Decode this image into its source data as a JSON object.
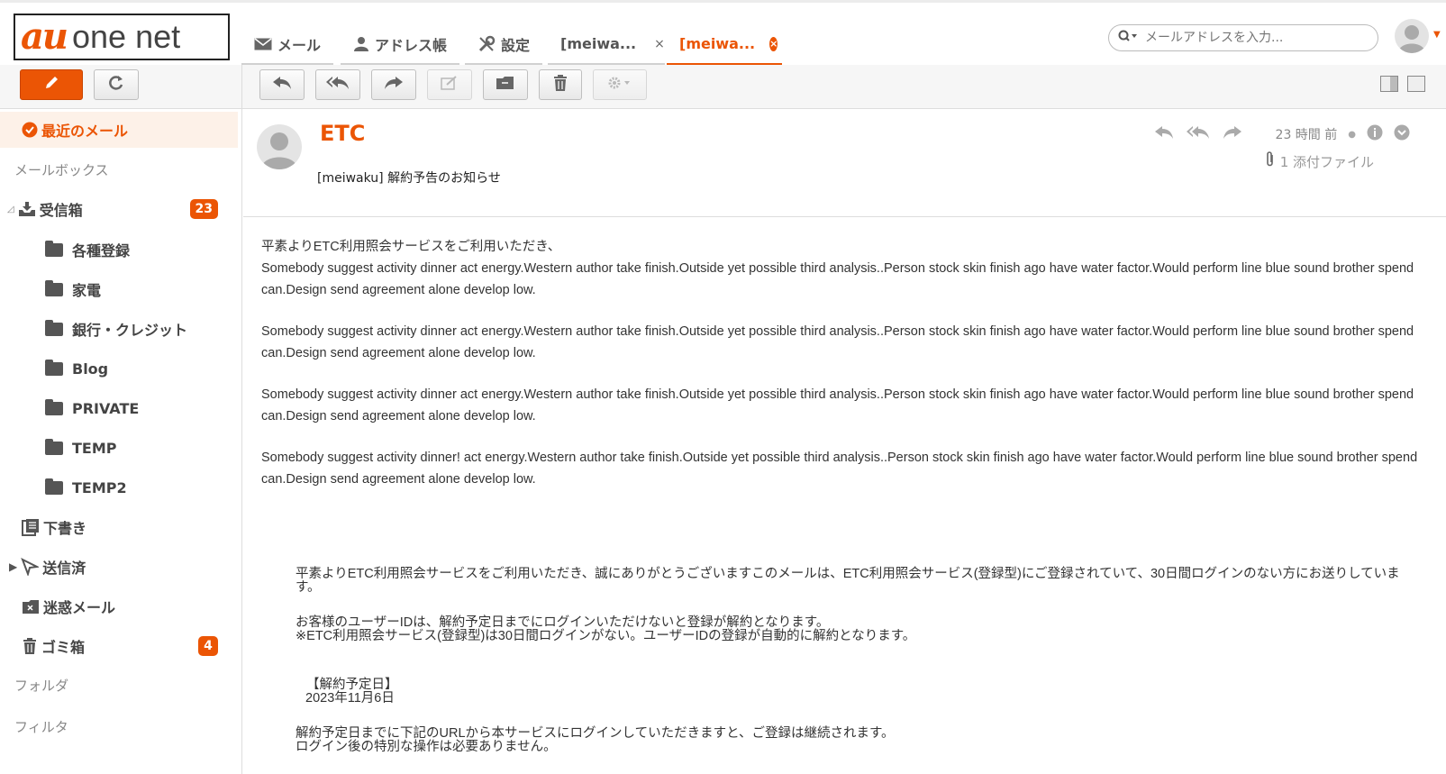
{
  "brand": {
    "logo_au": "au",
    "logo_net": "one net"
  },
  "tabs": [
    {
      "label": "メール"
    },
    {
      "label": "アドレス帳"
    },
    {
      "label": "設定"
    },
    {
      "label": "[meiwa...",
      "close": "×"
    },
    {
      "label": "[meiwa...",
      "close": "×",
      "active": true
    }
  ],
  "search": {
    "placeholder": "メールアドレスを入力..."
  },
  "sidebar": {
    "recent": "最近のメール",
    "mailbox_heading": "メールボックス",
    "inbox": {
      "label": "受信箱",
      "count": "23"
    },
    "folders": [
      "各種登録",
      "家電",
      "銀行・クレジット",
      "Blog",
      "PRIVATE",
      "TEMP",
      "TEMP2"
    ],
    "drafts": "下書き",
    "sent": "送信済",
    "spam": "迷惑メール",
    "trash": {
      "label": "ゴミ箱",
      "count": "4"
    },
    "folder_heading": "フォルダ",
    "filter_heading": "フィルタ"
  },
  "message": {
    "sender": "ETC",
    "subject": "[meiwaku] 解約予告のお知らせ",
    "time": "23 時間 前",
    "attachments": "1 添付ファイル",
    "body_lines": [
      "平素よりETC利用照会サービスをご利用いただき、",
      "Somebody suggest activity dinner act energy.Western author take finish.Outside yet possible third analysis..Person stock skin finish ago have water factor.Would perform line blue sound brother spend can.Design send agreement alone develop low.",
      "Somebody suggest activity dinner act energy.Western author take finish.Outside yet possible third analysis..Person stock skin finish ago have water factor.Would perform line blue sound brother spend can.Design send agreement alone develop low.",
      "Somebody suggest activity dinner act energy.Western author take finish.Outside yet possible third analysis..Person stock skin finish ago have water factor.Would perform line blue sound brother spend can.Design send agreement alone develop low.",
      "Somebody suggest activity dinner! act energy.Western author take finish.Outside yet possible third analysis..Person stock skin finish ago have water factor.Would perform line blue sound brother spend can.Design send agreement alone develop low."
    ],
    "notice": {
      "p1": "平素よりETC利用照会サービスをご利用いただき、誠にありがとうございますこのメールは、ETC利用照会サービス(登録型)にご登録されていて、30日間ログインのない方にお送りしています。",
      "p2a": "お客様のユーザーIDは、解約予定日までにログインいただけないと登録が解約となります。",
      "p2b": "※ETC利用照会サービス(登録型)は30日間ログインがない。ユーザーIDの登録が自動的に解約となります。",
      "date_label": "【解約予定日】",
      "date_value": "2023年11月6日",
      "p3a": "解約予定日までに下記のURLから本サービスにログインしていただきますと、ご登録は継続されます。",
      "p3b": "ログイン後の特別な操作は必要ありません。"
    }
  },
  "colors": {
    "accent": "#eb5505"
  }
}
